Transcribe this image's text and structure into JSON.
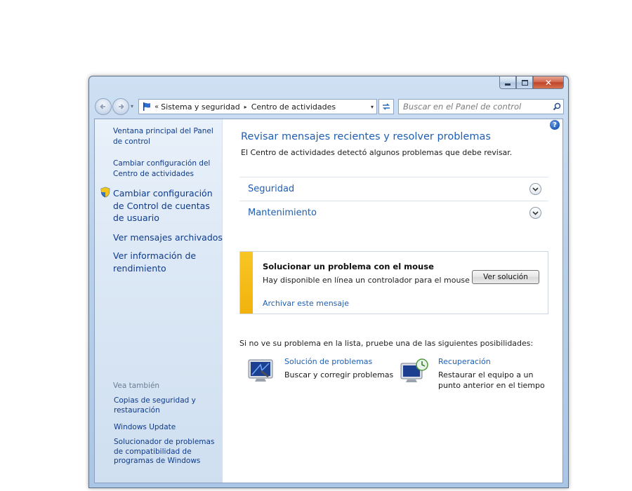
{
  "window": {
    "caption_buttons": [
      "minimize-icon",
      "maximize-icon",
      "close-icon"
    ],
    "close_glyph": "✕"
  },
  "navbar": {
    "back_icon": "back-arrow-icon",
    "forward_icon": "forward-arrow-icon",
    "address": {
      "overflow_glyph": "«",
      "segments": [
        "Sistema y seguridad",
        "Centro de actividades"
      ],
      "separator_glyph": "▸",
      "dropdown_glyph": "▾"
    },
    "refresh_glyph": "↹",
    "search_placeholder": "Buscar en el Panel de control"
  },
  "sidebar": {
    "links": [
      "Ventana principal del Panel de control",
      "Cambiar configuración del Centro de actividades",
      "Cambiar configuración de Control de cuentas de usuario",
      "Ver mensajes archivados",
      "Ver información de rendimiento"
    ],
    "see_also_label": "Vea también",
    "see_also": [
      "Copias de seguridad y restauración",
      "Windows Update",
      "Solucionador de problemas de compatibilidad de programas de Windows"
    ]
  },
  "main": {
    "help_glyph": "?",
    "title": "Revisar mensajes recientes y resolver problemas",
    "description": "El Centro de actividades detectó algunos problemas que debe revisar.",
    "sections": [
      {
        "label": "Seguridad",
        "icon": "chevron-down-icon"
      },
      {
        "label": "Mantenimiento",
        "icon": "chevron-down-icon"
      }
    ],
    "message": {
      "title": "Solucionar un problema con el mouse",
      "text": "Hay disponible en línea un controlador para el mouse",
      "button": "Ver solución",
      "archive_link": "Archivar este mensaje",
      "accent_color": "#f2b20c"
    },
    "not_found_text": "Si no ve su problema en la lista, pruebe una de las siguientes posibilidades:",
    "tools": [
      {
        "title": "Solución de problemas",
        "desc": "Buscar y corregir problemas",
        "icon": "troubleshooting-icon"
      },
      {
        "title": "Recuperación",
        "desc_lines": [
          "Restaurar el equipo a un",
          "punto anterior en el tiempo"
        ],
        "icon": "recovery-icon"
      }
    ]
  },
  "colors": {
    "link": "#1e5fb4",
    "sidebar_link": "#0e3a8a",
    "close_button": "#c0432a"
  }
}
